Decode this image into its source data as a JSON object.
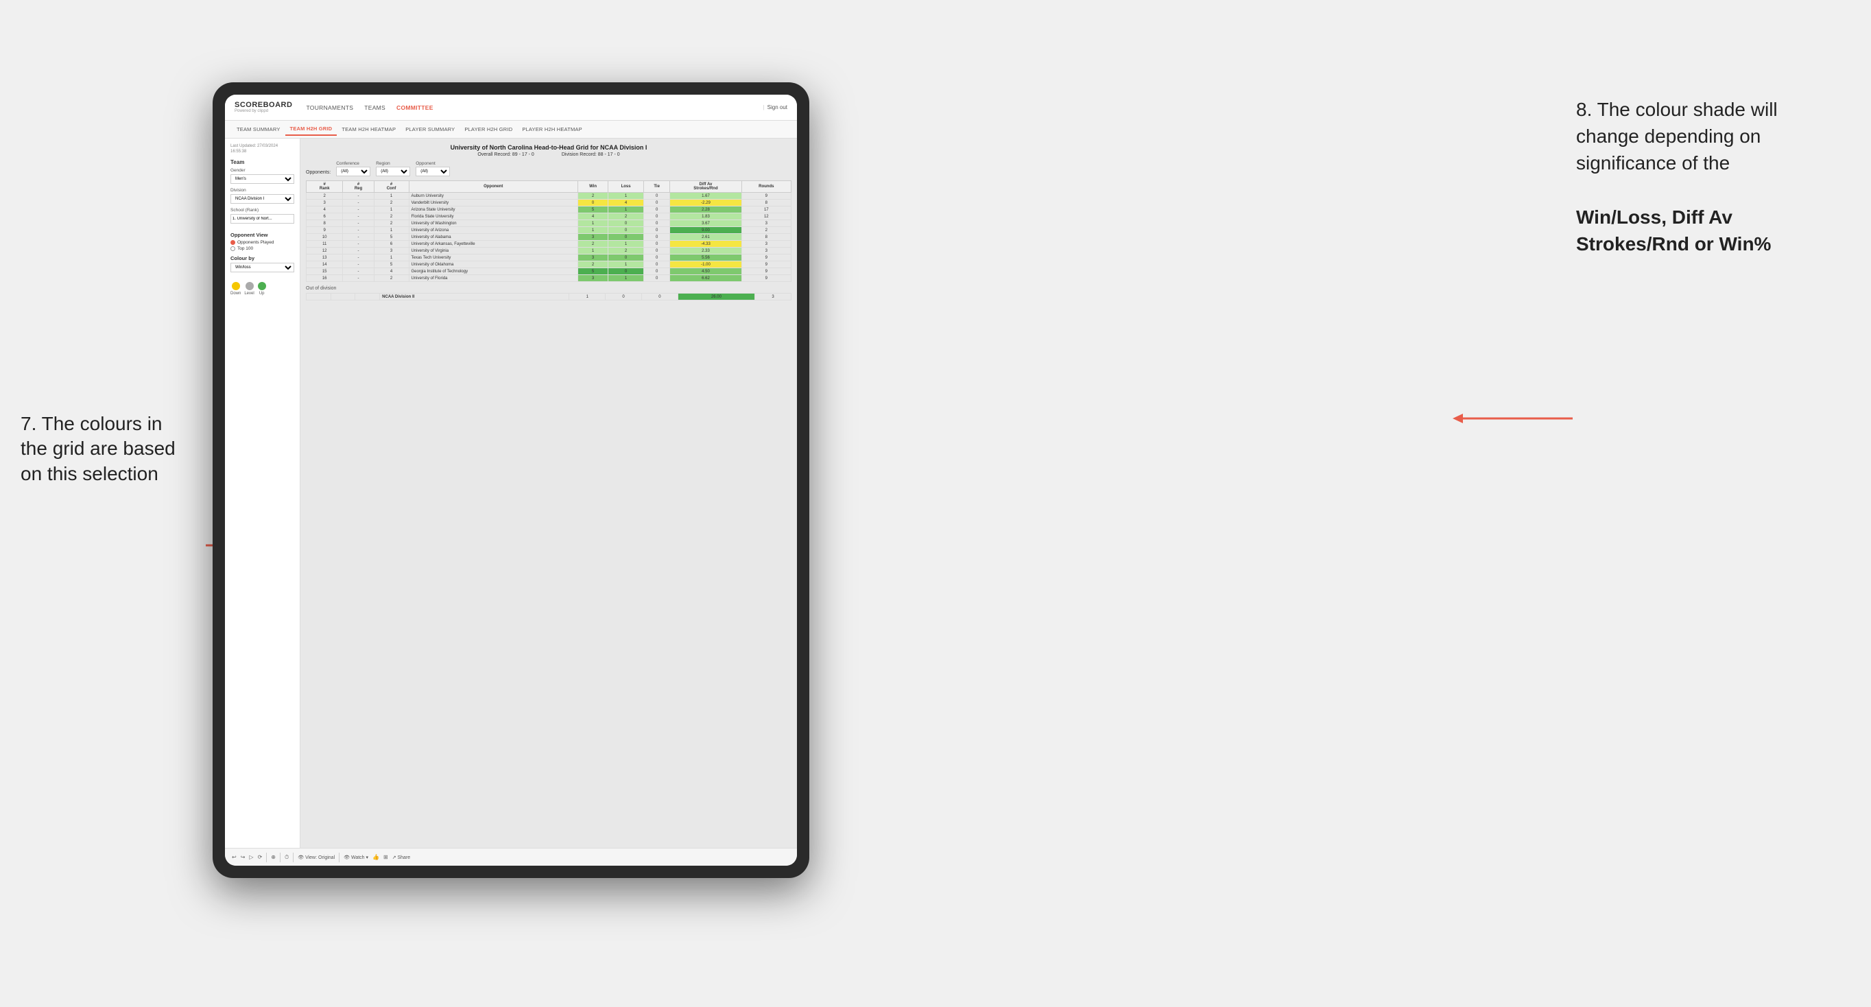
{
  "app": {
    "logo": "SCOREBOARD",
    "logo_sub": "Powered by clippd",
    "nav": [
      "TOURNAMENTS",
      "TEAMS",
      "COMMITTEE"
    ],
    "sign_out": "Sign out",
    "sub_nav": [
      "TEAM SUMMARY",
      "TEAM H2H GRID",
      "TEAM H2H HEATMAP",
      "PLAYER SUMMARY",
      "PLAYER H2H GRID",
      "PLAYER H2H HEATMAP"
    ]
  },
  "left_panel": {
    "meta": "Last Updated: 27/03/2024\n16:55:38",
    "team_label": "Team",
    "gender_label": "Gender",
    "gender_value": "Men's",
    "division_label": "Division",
    "division_value": "NCAA Division I",
    "school_label": "School (Rank)",
    "school_value": "1. University of Nort...",
    "opponent_view_title": "Opponent View",
    "radio_options": [
      "Opponents Played",
      "Top 100"
    ],
    "colour_by_label": "Colour by",
    "colour_by_value": "Win/loss",
    "legend": [
      {
        "color": "#f5c700",
        "label": "Down"
      },
      {
        "color": "#aaaaaa",
        "label": "Level"
      },
      {
        "color": "#4caf50",
        "label": "Up"
      }
    ]
  },
  "grid": {
    "title": "University of North Carolina Head-to-Head Grid for NCAA Division I",
    "overall_record": "Overall Record: 89 - 17 - 0",
    "division_record": "Division Record: 88 - 17 - 0",
    "filters": {
      "opponents_label": "Opponents:",
      "conference_label": "Conference",
      "conference_value": "(All)",
      "region_label": "Region",
      "region_value": "(All)",
      "opponent_label": "Opponent",
      "opponent_value": "(All)"
    },
    "columns": [
      "#\nRank",
      "#\nReg",
      "#\nConf",
      "Opponent",
      "Win",
      "Loss",
      "Tie",
      "Diff Av\nStrokes/Rnd",
      "Rounds"
    ],
    "rows": [
      {
        "rank": "2",
        "reg": "-",
        "conf": "1",
        "opponent": "Auburn University",
        "win": "2",
        "loss": "1",
        "tie": "0",
        "diff": "1.67",
        "rounds": "9",
        "win_color": "green_light",
        "diff_color": "green_light"
      },
      {
        "rank": "3",
        "reg": "-",
        "conf": "2",
        "opponent": "Vanderbilt University",
        "win": "0",
        "loss": "4",
        "tie": "0",
        "diff": "-2.29",
        "rounds": "8",
        "win_color": "yellow",
        "diff_color": "yellow"
      },
      {
        "rank": "4",
        "reg": "-",
        "conf": "1",
        "opponent": "Arizona State University",
        "win": "5",
        "loss": "1",
        "tie": "0",
        "diff": "2.28",
        "rounds": "17",
        "win_color": "green_mid",
        "diff_color": "green_mid"
      },
      {
        "rank": "6",
        "reg": "-",
        "conf": "2",
        "opponent": "Florida State University",
        "win": "4",
        "loss": "2",
        "tie": "0",
        "diff": "1.83",
        "rounds": "12",
        "win_color": "green_light",
        "diff_color": "green_light"
      },
      {
        "rank": "8",
        "reg": "-",
        "conf": "2",
        "opponent": "University of Washington",
        "win": "1",
        "loss": "0",
        "tie": "0",
        "diff": "3.67",
        "rounds": "3",
        "win_color": "green_light",
        "diff_color": "green_light"
      },
      {
        "rank": "9",
        "reg": "-",
        "conf": "1",
        "opponent": "University of Arizona",
        "win": "1",
        "loss": "0",
        "tie": "0",
        "diff": "9.00",
        "rounds": "2",
        "win_color": "green_light",
        "diff_color": "green_dark"
      },
      {
        "rank": "10",
        "reg": "-",
        "conf": "5",
        "opponent": "University of Alabama",
        "win": "3",
        "loss": "0",
        "tie": "0",
        "diff": "2.61",
        "rounds": "8",
        "win_color": "green_mid",
        "diff_color": "green_light"
      },
      {
        "rank": "11",
        "reg": "-",
        "conf": "6",
        "opponent": "University of Arkansas, Fayetteville",
        "win": "2",
        "loss": "1",
        "tie": "0",
        "diff": "-4.33",
        "rounds": "3",
        "win_color": "green_light",
        "diff_color": "yellow"
      },
      {
        "rank": "12",
        "reg": "-",
        "conf": "3",
        "opponent": "University of Virginia",
        "win": "1",
        "loss": "2",
        "tie": "0",
        "diff": "2.33",
        "rounds": "3",
        "win_color": "green_light",
        "diff_color": "green_light"
      },
      {
        "rank": "13",
        "reg": "-",
        "conf": "1",
        "opponent": "Texas Tech University",
        "win": "3",
        "loss": "0",
        "tie": "0",
        "diff": "5.56",
        "rounds": "9",
        "win_color": "green_mid",
        "diff_color": "green_mid"
      },
      {
        "rank": "14",
        "reg": "-",
        "conf": "5",
        "opponent": "University of Oklahoma",
        "win": "2",
        "loss": "1",
        "tie": "0",
        "diff": "-1.00",
        "rounds": "9",
        "win_color": "green_light",
        "diff_color": "yellow"
      },
      {
        "rank": "15",
        "reg": "-",
        "conf": "4",
        "opponent": "Georgia Institute of Technology",
        "win": "5",
        "loss": "0",
        "tie": "0",
        "diff": "4.50",
        "rounds": "9",
        "win_color": "green_dark",
        "diff_color": "green_mid"
      },
      {
        "rank": "16",
        "reg": "-",
        "conf": "2",
        "opponent": "University of Florida",
        "win": "3",
        "loss": "1",
        "tie": "0",
        "diff": "6.62",
        "rounds": "9",
        "win_color": "green_mid",
        "diff_color": "green_mid"
      }
    ],
    "out_of_division_label": "Out of division",
    "out_of_division_rows": [
      {
        "opponent": "NCAA Division II",
        "win": "1",
        "loss": "0",
        "tie": "0",
        "diff": "26.00",
        "rounds": "3",
        "diff_color": "green_dark"
      }
    ]
  },
  "toolbar": {
    "view_label": "View: Original",
    "watch_label": "Watch",
    "share_label": "Share"
  },
  "annotations": {
    "left_title": "7. The colours in the grid are based on this selection",
    "right_title": "8. The colour shade will change depending on significance of the",
    "right_bold": "Win/Loss, Diff Av Strokes/Rnd or Win%"
  }
}
